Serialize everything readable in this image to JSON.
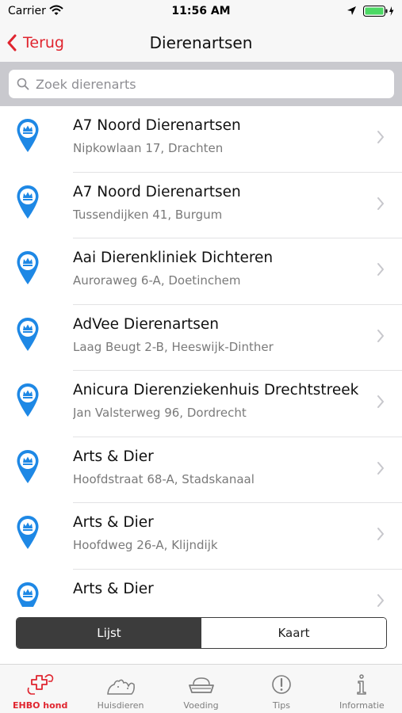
{
  "status_bar": {
    "carrier": "Carrier",
    "time": "11:56 AM"
  },
  "nav": {
    "back_label": "Terug",
    "title": "Dierenartsen"
  },
  "search": {
    "placeholder": "Zoek dierenarts",
    "value": ""
  },
  "colors": {
    "accent": "#e0252f",
    "pin": "#1e88e5",
    "segment_active": "#3c3c3c"
  },
  "vets": [
    {
      "name": "A7 Noord Dierenartsen",
      "address": "Nipkowlaan 17, Drachten"
    },
    {
      "name": "A7 Noord Dierenartsen",
      "address": "Tussendijken 41, Burgum"
    },
    {
      "name": "Aai Dierenkliniek Dichteren",
      "address": "Auroraweg 6-A, Doetinchem"
    },
    {
      "name": "AdVee Dierenartsen",
      "address": "Laag Beugt 2-B, Heeswijk-Dinther"
    },
    {
      "name": "Anicura Dierenziekenhuis Drechtstreek",
      "address": "Jan Valsterweg 96, Dordrecht"
    },
    {
      "name": "Arts & Dier",
      "address": "Hoofdstraat 68-A, Stadskanaal"
    },
    {
      "name": "Arts & Dier",
      "address": "Hoofdweg 26-A, Klijndijk"
    },
    {
      "name": "Arts & Dier",
      "address": ""
    }
  ],
  "segments": {
    "list_label": "Lijst",
    "map_label": "Kaart",
    "selected": "Lijst"
  },
  "tabs": [
    {
      "label": "EHBO hond",
      "icon": "first-aid-icon",
      "active": true
    },
    {
      "label": "Huisdieren",
      "icon": "pets-icon",
      "active": false
    },
    {
      "label": "Voeding",
      "icon": "food-bowl-icon",
      "active": false
    },
    {
      "label": "Tips",
      "icon": "exclamation-icon",
      "active": false
    },
    {
      "label": "Informatie",
      "icon": "info-icon",
      "active": false
    }
  ]
}
